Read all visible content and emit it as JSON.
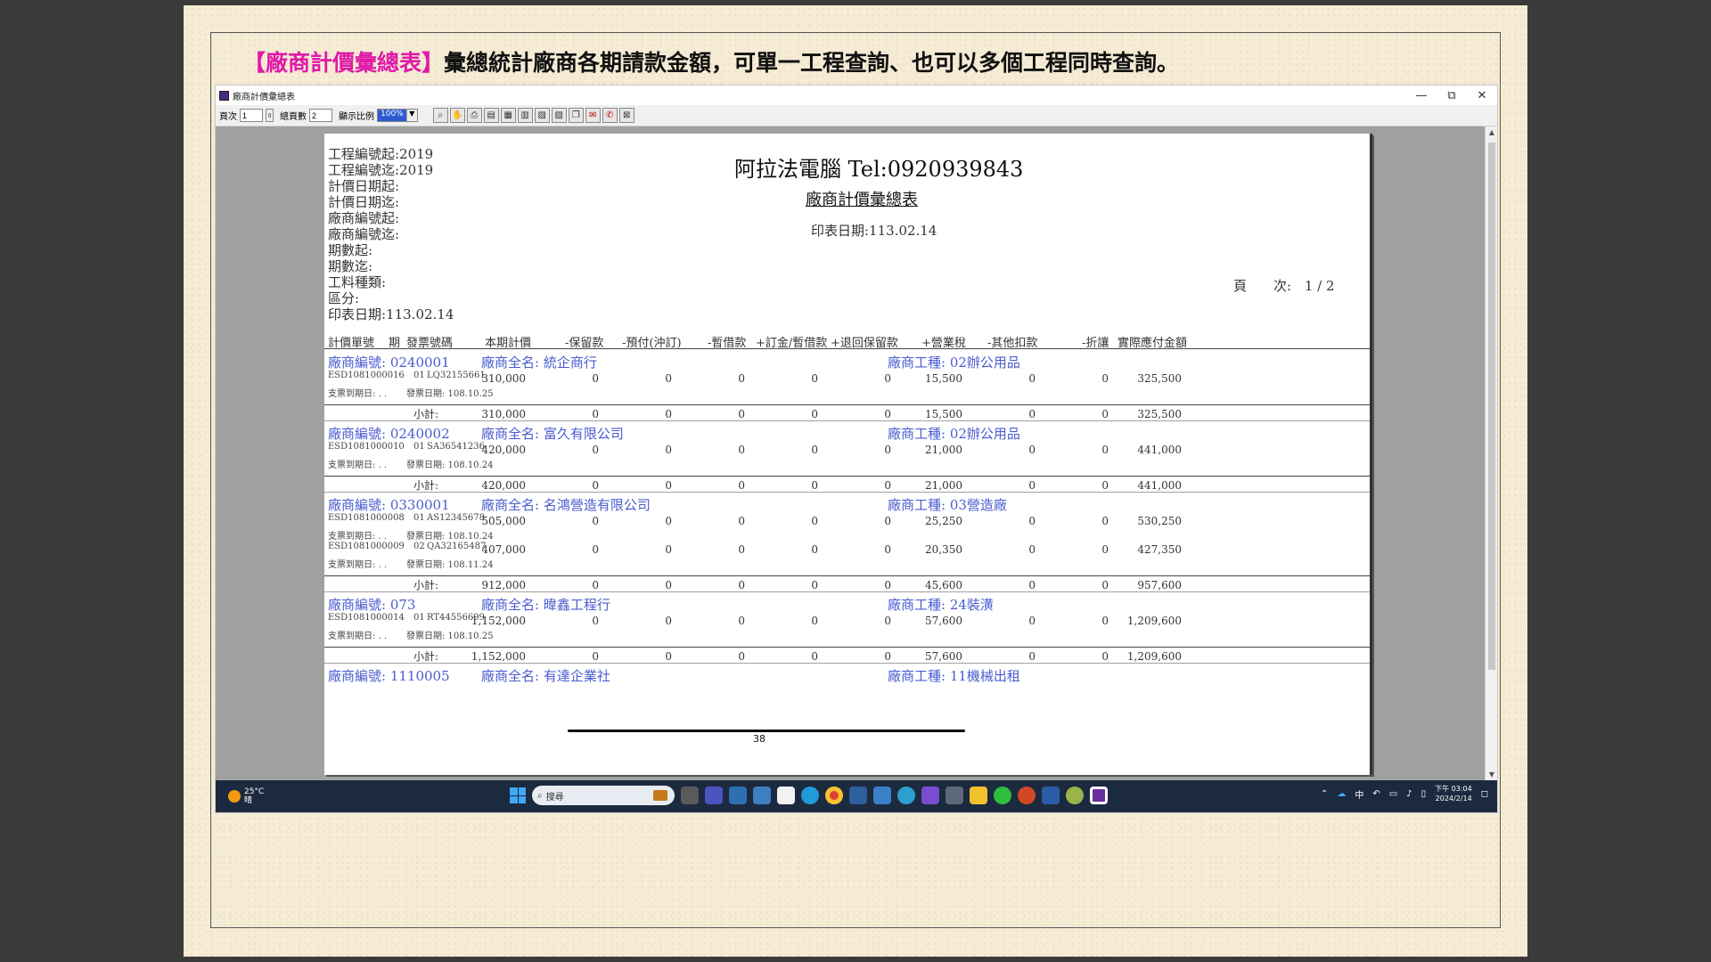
{
  "headline": {
    "highlight": "【廠商計價彙總表】",
    "text": "彙總統計廠商各期請款金額，可單一工程查詢、也可以多個工程同時查詢。"
  },
  "window": {
    "title": "廠商計價彙總表",
    "minimize": "—",
    "restore": "⧉",
    "close": "✕"
  },
  "toolbar": {
    "page_label": "頁次",
    "page_value": "1",
    "total_label": "總頁數",
    "total_value": "2",
    "zoom_label": "顯示比例",
    "zoom_value": "100%"
  },
  "report": {
    "criteria": [
      "工程編號起:2019",
      "工程編號迄:2019",
      "計價日期起:",
      "計價日期迄:",
      "廠商編號起:",
      "廠商編號迄:",
      "期數起:",
      "期數迄:",
      "工料種類:",
      "區分:",
      "印表日期:113.02.14"
    ],
    "company": "阿拉法電腦 Tel:0920939843",
    "title": "廠商計價彙總表",
    "print_date": "印表日期:113.02.14",
    "page_label": "頁　　次:",
    "page_value": "1  /  2",
    "columns": [
      "計價單號",
      "期",
      "發票號碼",
      "本期計價",
      "-保留款",
      "-預付(沖訂)",
      "-暫借款",
      "+訂金/暫借款",
      "+退回保留款",
      "+營業稅",
      "-其他扣款",
      "-折讓",
      "實際應付金額"
    ],
    "vendors": [
      {
        "code": "廠商編號: 0240001",
        "name": "廠商全名: 統企商行",
        "trade": "廠商工種: 02辦公用品",
        "rows": [
          {
            "id": "ESD1081000016",
            "period": "01",
            "invoice": "LQ32155661",
            "due": "支票到期日:  .  .",
            "inv_date": "發票日期: 108.10.25",
            "vals": [
              "310,000",
              "0",
              "0",
              "0",
              "0",
              "0",
              "15,500",
              "0",
              "0",
              "325,500"
            ]
          }
        ],
        "subtotal_label": "小計:",
        "subtotal": [
          "310,000",
          "0",
          "0",
          "0",
          "0",
          "0",
          "15,500",
          "0",
          "0",
          "325,500"
        ]
      },
      {
        "code": "廠商編號: 0240002",
        "name": "廠商全名: 富久有限公司",
        "trade": "廠商工種: 02辦公用品",
        "rows": [
          {
            "id": "ESD1081000010",
            "period": "01",
            "invoice": "SA36541236",
            "due": "支票到期日:  .  .",
            "inv_date": "發票日期: 108.10.24",
            "vals": [
              "420,000",
              "0",
              "0",
              "0",
              "0",
              "0",
              "21,000",
              "0",
              "0",
              "441,000"
            ]
          }
        ],
        "subtotal_label": "小計:",
        "subtotal": [
          "420,000",
          "0",
          "0",
          "0",
          "0",
          "0",
          "21,000",
          "0",
          "0",
          "441,000"
        ]
      },
      {
        "code": "廠商編號: 0330001",
        "name": "廠商全名: 名鴻營造有限公司",
        "trade": "廠商工種: 03營造廠",
        "rows": [
          {
            "id": "ESD1081000008",
            "period": "01",
            "invoice": "AS12345678",
            "due": "支票到期日:  .  .",
            "inv_date": "發票日期: 108.10.24",
            "vals": [
              "505,000",
              "0",
              "0",
              "0",
              "0",
              "0",
              "25,250",
              "0",
              "0",
              "530,250"
            ]
          },
          {
            "id": "ESD1081000009",
            "period": "02",
            "invoice": "QA32165487",
            "due": "支票到期日:  .  .",
            "inv_date": "發票日期: 108.11.24",
            "vals": [
              "407,000",
              "0",
              "0",
              "0",
              "0",
              "0",
              "20,350",
              "0",
              "0",
              "427,350"
            ]
          }
        ],
        "subtotal_label": "小計:",
        "subtotal": [
          "912,000",
          "0",
          "0",
          "0",
          "0",
          "0",
          "45,600",
          "0",
          "0",
          "957,600"
        ]
      },
      {
        "code": "廠商編號: 073",
        "name": "廠商全名: 暐鑫工程行",
        "trade": "廠商工種: 24裝潢",
        "rows": [
          {
            "id": "ESD1081000014",
            "period": "01",
            "invoice": "RT44556699",
            "due": "支票到期日:  .  .",
            "inv_date": "發票日期: 108.10.25",
            "vals": [
              "1,152,000",
              "0",
              "0",
              "0",
              "0",
              "0",
              "57,600",
              "0",
              "0",
              "1,209,600"
            ]
          }
        ],
        "subtotal_label": "小計:",
        "subtotal": [
          "1,152,000",
          "0",
          "0",
          "0",
          "0",
          "0",
          "57,600",
          "0",
          "0",
          "1,209,600"
        ]
      },
      {
        "code": "廠商編號: 1110005",
        "name": "廠商全名: 有達企業社",
        "trade": "廠商工種: 11機械出租",
        "rows": [],
        "subtotal_label": "",
        "subtotal": []
      }
    ]
  },
  "taskbar": {
    "temp": "25°C",
    "cond": "晴",
    "search_placeholder": "搜尋",
    "ime": "中",
    "time": "下午 03:04",
    "date": "2024/2/14"
  },
  "footer": {
    "page_number": "38"
  }
}
